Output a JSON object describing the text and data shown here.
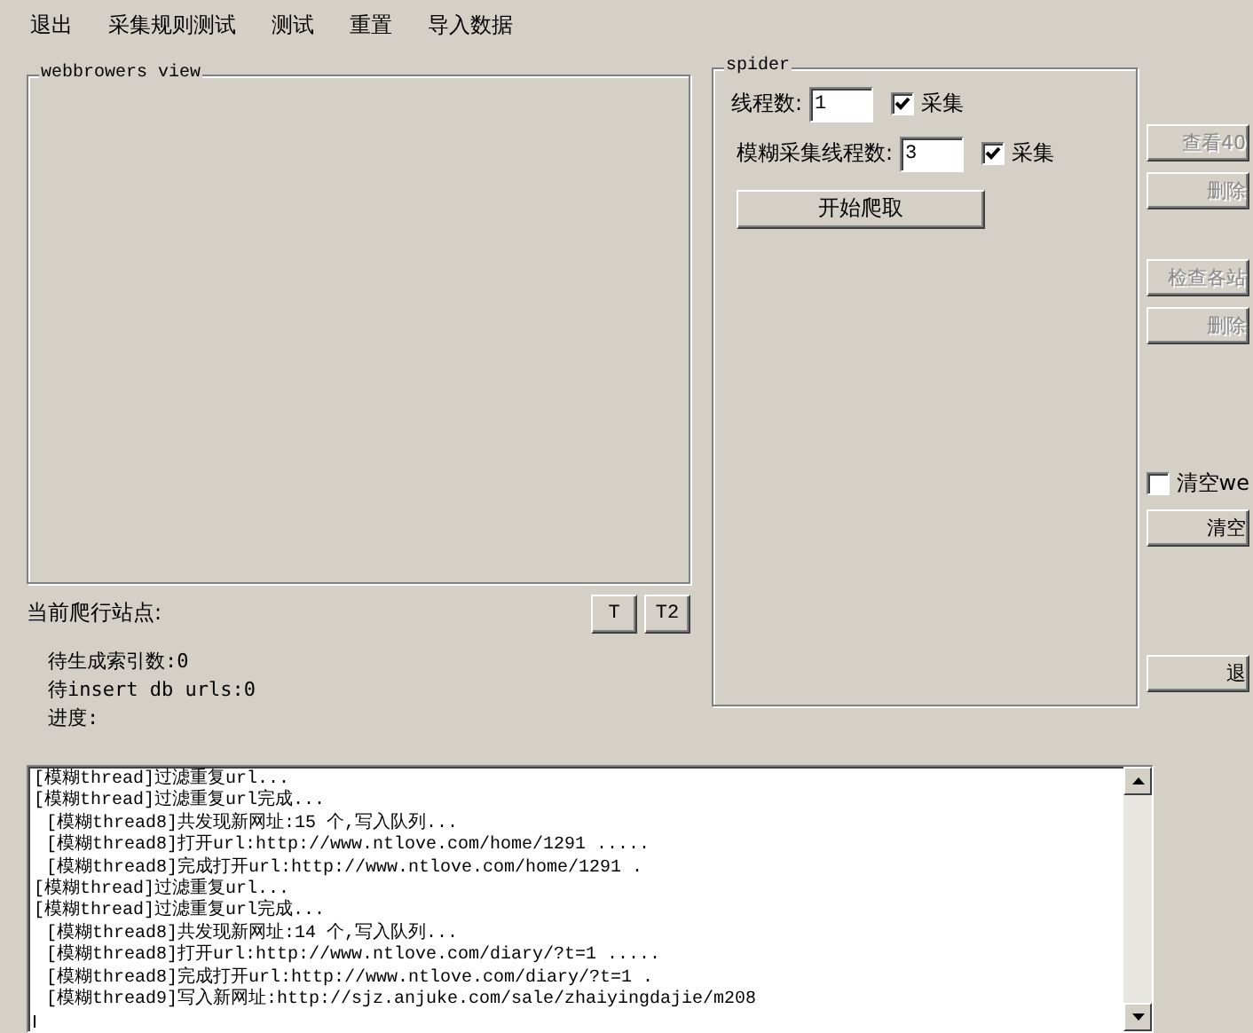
{
  "menu": [
    {
      "label": "退出"
    },
    {
      "label": "采集规则测试"
    },
    {
      "label": "测试"
    },
    {
      "label": "重置"
    },
    {
      "label": "导入数据"
    }
  ],
  "browser_panel": {
    "title": "webbrowers view"
  },
  "current_site": {
    "label": "当前爬行站点:",
    "buttons": [
      "T",
      "T2"
    ]
  },
  "stats": [
    "待生成索引数:0",
    "待insert db urls:0",
    "进度:"
  ],
  "spider": {
    "title": "spider",
    "rows": [
      {
        "label": "线程数:",
        "value": "1",
        "checkbox_label": "采集",
        "checked": true
      },
      {
        "label": "模糊采集线程数:",
        "value": "3",
        "checkbox_label": "采集",
        "checked": true
      }
    ],
    "start_button": "开始爬取"
  },
  "side_controls": [
    {
      "kind": "button",
      "label": "查看40",
      "disabled": true
    },
    {
      "kind": "button",
      "label": "删除",
      "disabled": true
    },
    {
      "kind": "gap"
    },
    {
      "kind": "button",
      "label": "检查各站",
      "disabled": true
    },
    {
      "kind": "button",
      "label": "删除",
      "disabled": true
    },
    {
      "kind": "gap"
    },
    {
      "kind": "checkbox",
      "label": "清空we",
      "checked": false
    },
    {
      "kind": "button",
      "label": "清空",
      "disabled": false
    },
    {
      "kind": "gap"
    },
    {
      "kind": "button",
      "label": "退",
      "disabled": false
    }
  ],
  "log": [
    {
      "text": "[模糊thread]过滤重复url...",
      "indented": false
    },
    {
      "text": "[模糊thread]过滤重复url完成...",
      "indented": false
    },
    {
      "text": "[模糊thread8]共发现新网址:15 个,写入队列...",
      "indented": true
    },
    {
      "text": "[模糊thread8]打开url:http://www.ntlove.com/home/1291 .....",
      "indented": true
    },
    {
      "text": "[模糊thread8]完成打开url:http://www.ntlove.com/home/1291 .",
      "indented": true
    },
    {
      "text": "[模糊thread]过滤重复url...",
      "indented": false
    },
    {
      "text": "[模糊thread]过滤重复url完成...",
      "indented": false
    },
    {
      "text": "[模糊thread8]共发现新网址:14 个,写入队列...",
      "indented": true
    },
    {
      "text": "[模糊thread8]打开url:http://www.ntlove.com/diary/?t=1 .....",
      "indented": true
    },
    {
      "text": "[模糊thread8]完成打开url:http://www.ntlove.com/diary/?t=1 .",
      "indented": true
    },
    {
      "text": "[模糊thread9]写入新网址:http://sjz.anjuke.com/sale/zhaiyingdajie/m208",
      "indented": true
    }
  ]
}
